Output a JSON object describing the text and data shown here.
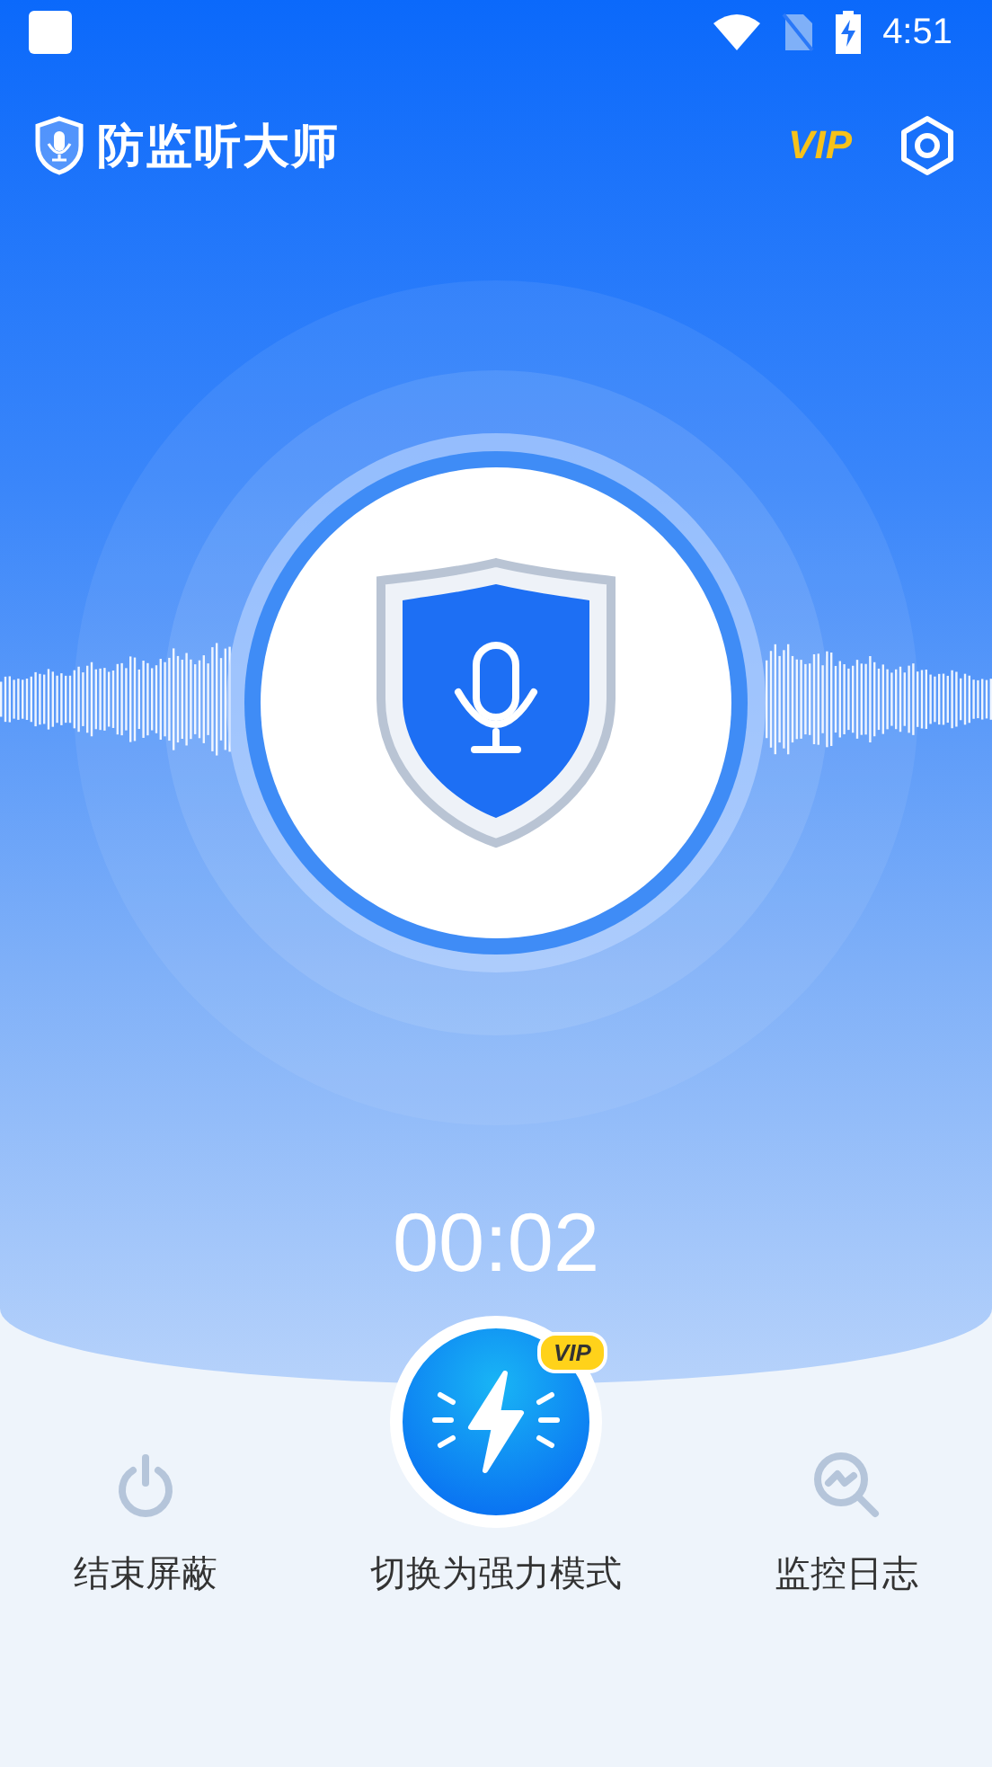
{
  "status_bar": {
    "time": "4:51"
  },
  "header": {
    "title": "防监听大师",
    "vip_label": "VIP"
  },
  "timer": "00:02",
  "actions": [
    {
      "kind": "power",
      "label": "结束屏蔽"
    },
    {
      "kind": "boost",
      "label": "切换为强力模式",
      "badge": "VIP"
    },
    {
      "kind": "log",
      "label": "监控日志"
    }
  ]
}
